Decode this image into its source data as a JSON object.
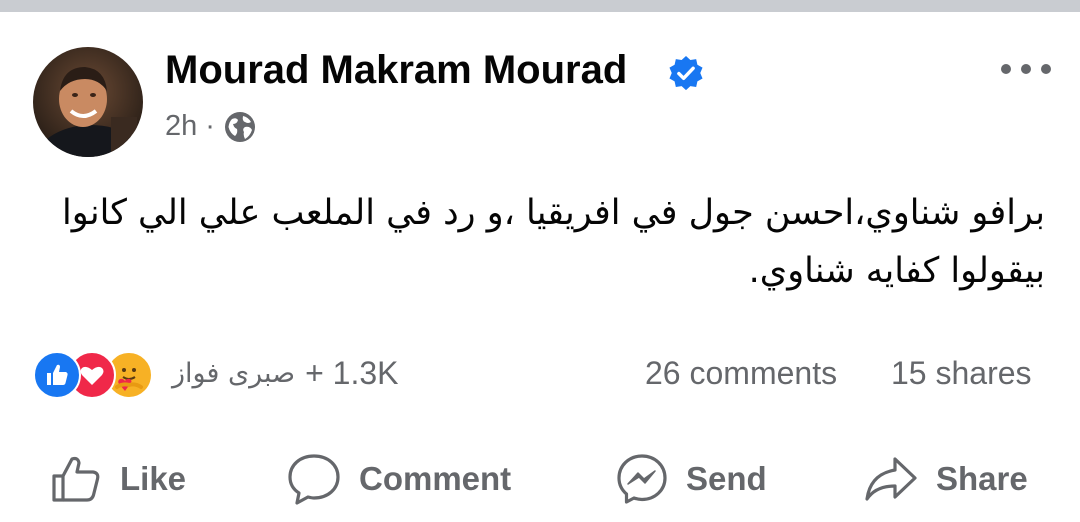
{
  "post": {
    "author": "Mourad Makram Mourad",
    "verified": true,
    "time": "2h",
    "separator": "·",
    "audience_icon": "globe-icon",
    "text": "برافو شناوي،احسن جول في افريقيا ،و رد في الملعب علي الي كانوا بيقولوا كفايه شناوي."
  },
  "stats": {
    "reaction_icons": [
      "like-reaction-icon",
      "love-reaction-icon",
      "care-reaction-icon"
    ],
    "reactor_name": "صبرى فواز",
    "reaction_count": "+ 1.3K",
    "comments": "26 comments",
    "shares": "15 shares"
  },
  "actions": {
    "like": "Like",
    "comment": "Comment",
    "send": "Send",
    "share": "Share"
  },
  "colors": {
    "brand_blue": "#1877f2",
    "secondary_text": "#65676b",
    "love_red": "#f02849",
    "care_yellow": "#f7b125"
  }
}
